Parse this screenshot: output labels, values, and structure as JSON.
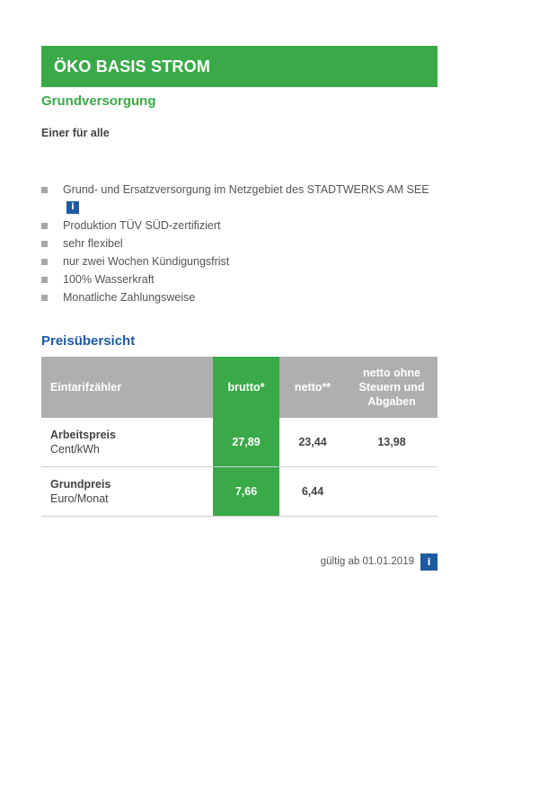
{
  "product": {
    "title": "ÖKO BASIS STROM",
    "subtitle": "Grundversorgung",
    "tagline": "Einer für alle"
  },
  "features": [
    "Grund- und Ersatzversorgung im Netzgebiet des STADTWERKS AM SEE",
    "Produktion TÜV SÜD-zertifiziert",
    "sehr flexibel",
    "nur zwei Wochen Kündigungsfrist",
    "100% Wasserkraft",
    "Monatliche Zahlungsweise"
  ],
  "info_icon": "i",
  "price_section": {
    "title": "Preisübersicht",
    "headers": {
      "meter": "Eintarifzähler",
      "brutto": "brutto*",
      "netto": "netto**",
      "netto_ohne": "netto ohne Steuern und Abgaben"
    },
    "rows": [
      {
        "name": "Arbeitspreis",
        "unit": "Cent/kWh",
        "brutto": "27,89",
        "netto": "23,44",
        "netto_ohne": "13,98"
      },
      {
        "name": "Grundpreis",
        "unit": "Euro/Monat",
        "brutto": "7,66",
        "netto": "6,44",
        "netto_ohne": ""
      }
    ]
  },
  "validity": "gültig ab 01.01.2019",
  "colors": {
    "green": "#3aaa48",
    "blue": "#1e5aa0",
    "header_gray": "#afafaf"
  }
}
